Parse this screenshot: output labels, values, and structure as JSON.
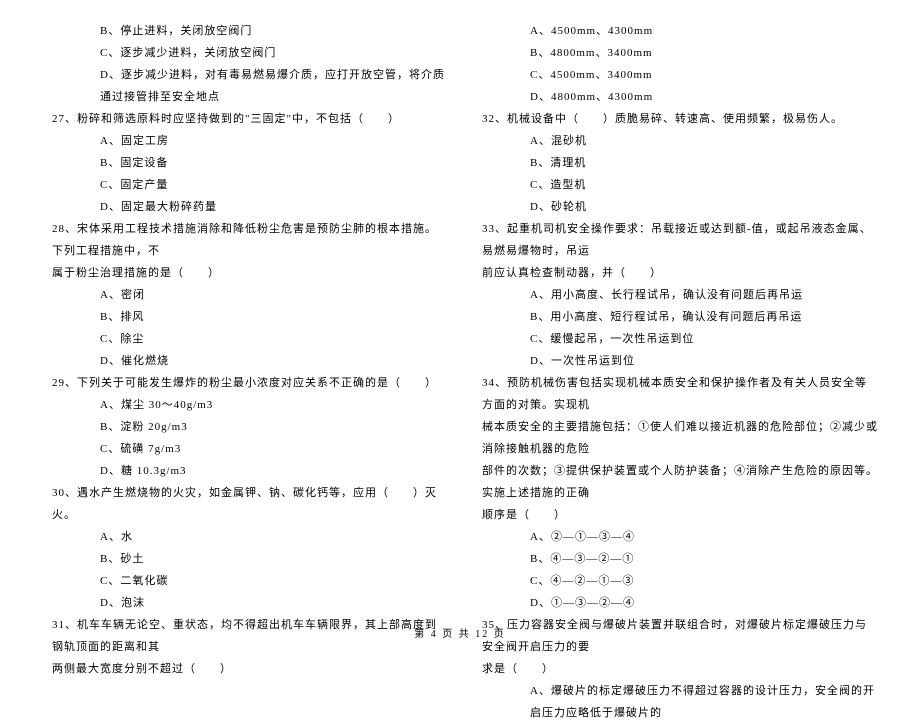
{
  "left_column": {
    "initial_options": [
      "B、停止进料，关闭放空阀门",
      "C、逐步减少进料，关闭放空阀门",
      "D、逐步减少进料，对有毒易燃易爆介质，应打开放空管，将介质通过接管排至安全地点"
    ],
    "q27": {
      "text": "27、粉碎和筛选原料时应坚持做到的\"三固定\"中，不包括（　　）",
      "options": [
        "A、固定工房",
        "B、固定设备",
        "C、固定产量",
        "D、固定最大粉碎药量"
      ]
    },
    "q28": {
      "text": "28、宋体采用工程技术措施消除和降低粉尘危害是预防尘肺的根本措施。下列工程措施中，不",
      "cont": "属于粉尘治理措施的是（　　）",
      "options": [
        "A、密闭",
        "B、排风",
        "C、除尘",
        "D、催化燃烧"
      ]
    },
    "q29": {
      "text": "29、下列关于可能发生爆炸的粉尘最小浓度对应关系不正确的是（　　）",
      "options": [
        "A、煤尘 30～40g/m3",
        "B、淀粉 20g/m3",
        "C、硫磺 7g/m3",
        "D、糖 10.3g/m3"
      ]
    },
    "q30": {
      "text": "30、遇水产生燃烧物的火灾，如金属钾、钠、碳化钙等，应用（　　）灭火。",
      "options": [
        "A、水",
        "B、砂土",
        "C、二氧化碳",
        "D、泡沫"
      ]
    },
    "q31": {
      "text": "31、机车车辆无论空、重状态，均不得超出机车车辆限界，其上部高度到钢轨顶面的距离和其",
      "cont": "两侧最大宽度分别不超过（　　）"
    }
  },
  "right_column": {
    "initial_options": [
      "A、4500mm、4300mm",
      "B、4800mm、3400mm",
      "C、4500mm、3400mm",
      "D、4800mm、4300mm"
    ],
    "q32": {
      "text": "32、机械设备中（　　）质脆易碎、转速高、使用频繁，极易伤人。",
      "options": [
        "A、混砂机",
        "B、清理机",
        "C、造型机",
        "D、砂轮机"
      ]
    },
    "q33": {
      "text": "33、起重机司机安全操作要求：吊载接近或达到额-值，或起吊液态金属、易燃易爆物时，吊运",
      "cont": "前应认真检查制动器，并（　　）",
      "options": [
        "A、用小高度、长行程试吊，确认没有问题后再吊运",
        "B、用小高度、短行程试吊，确认没有问题后再吊运",
        "C、缓慢起吊，一次性吊运到位",
        "D、一次性吊运到位"
      ]
    },
    "q34": {
      "text": "34、预防机械伤害包括实现机械本质安全和保护操作者及有关人员安全等方面的对策。实现机",
      "cont1": "械本质安全的主要措施包括：①使人们难以接近机器的危险部位；②减少或消除接触机器的危险",
      "cont2": "部件的次数；③提供保护装置或个人防护装备；④消除产生危险的原因等。实施上述措施的正确",
      "cont3": "顺序是（　　）",
      "options": [
        "A、②—①—③—④",
        "B、④—③—②—①",
        "C、④—②—①—③",
        "D、①—③—②—④"
      ]
    },
    "q35": {
      "text": "35、压力容器安全阀与爆破片装置并联组合时，对爆破片标定爆破压力与安全阀开启压力的要",
      "cont": "求是（　　）",
      "options": [
        "A、爆破片的标定爆破压力不得超过容器的设计压力，安全阀的开启压力应略低于爆破片的"
      ]
    }
  },
  "footer": "第 4 页 共 12 页"
}
